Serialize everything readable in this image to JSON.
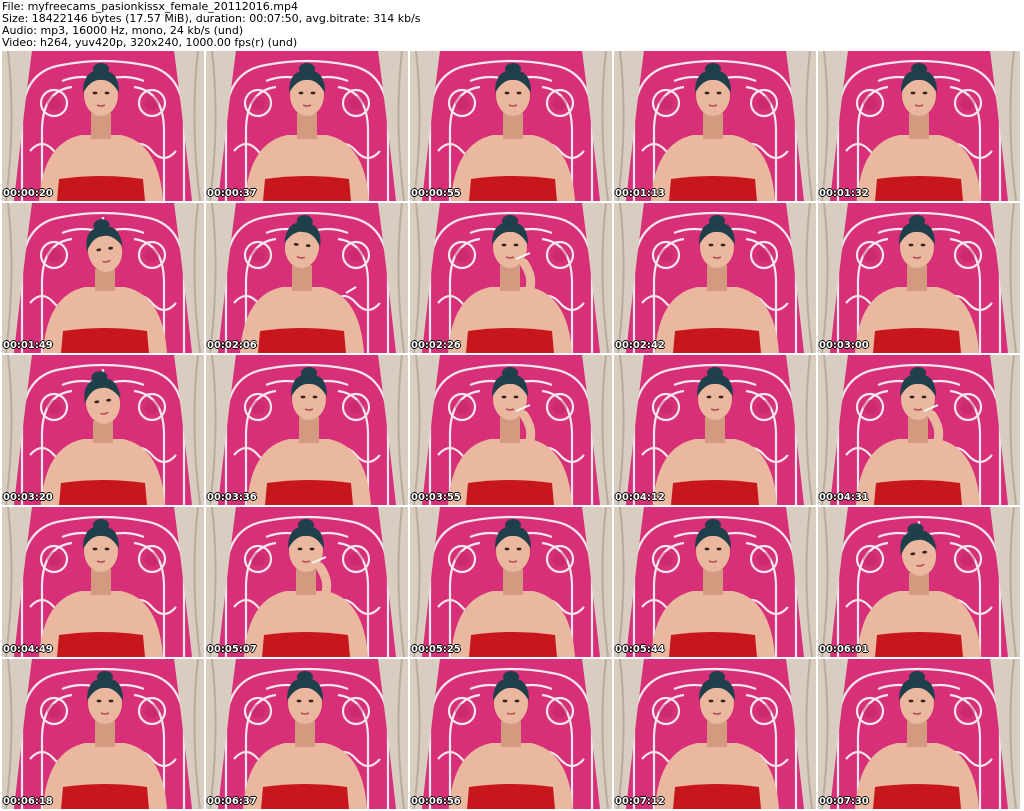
{
  "header": {
    "file": "File: myfreecams_pasionkissx_female_20112016.mp4",
    "size": "Size: 18422146 bytes (17.57 MiB), duration: 00:07:50, avg.bitrate: 314 kb/s",
    "audio": "Audio: mp3, 16000 Hz, mono, 24 kb/s (und)",
    "video": "Video: h264, yuv420p, 320x240, 1000.00 fps(r) (und)"
  },
  "thumbnails": [
    {
      "timestamp": "00:00:20",
      "pose": "neutral"
    },
    {
      "timestamp": "00:00:37",
      "pose": "neutral"
    },
    {
      "timestamp": "00:00:55",
      "pose": "neutral"
    },
    {
      "timestamp": "00:01:13",
      "pose": "neutral"
    },
    {
      "timestamp": "00:01:32",
      "pose": "neutral"
    },
    {
      "timestamp": "00:01:49",
      "pose": "down"
    },
    {
      "timestamp": "00:02:06",
      "pose": "lean"
    },
    {
      "timestamp": "00:02:26",
      "pose": "smoke"
    },
    {
      "timestamp": "00:02:42",
      "pose": "neutral"
    },
    {
      "timestamp": "00:03:00",
      "pose": "neutral"
    },
    {
      "timestamp": "00:03:20",
      "pose": "down"
    },
    {
      "timestamp": "00:03:36",
      "pose": "neutral"
    },
    {
      "timestamp": "00:03:55",
      "pose": "smoke"
    },
    {
      "timestamp": "00:04:12",
      "pose": "neutral"
    },
    {
      "timestamp": "00:04:31",
      "pose": "smoke"
    },
    {
      "timestamp": "00:04:49",
      "pose": "neutral"
    },
    {
      "timestamp": "00:05:07",
      "pose": "smoke"
    },
    {
      "timestamp": "00:05:25",
      "pose": "neutral"
    },
    {
      "timestamp": "00:05:44",
      "pose": "neutral"
    },
    {
      "timestamp": "00:06:01",
      "pose": "down"
    },
    {
      "timestamp": "00:06:18",
      "pose": "neutral"
    },
    {
      "timestamp": "00:06:37",
      "pose": "neutral"
    },
    {
      "timestamp": "00:06:56",
      "pose": "neutral"
    },
    {
      "timestamp": "00:07:12",
      "pose": "neutral"
    },
    {
      "timestamp": "00:07:30",
      "pose": "neutral"
    }
  ],
  "colors": {
    "wall": "#d72f78",
    "wall_dark": "#b91f5f",
    "headboard": "#f3e6ec",
    "curtain": "#d8cdc0",
    "curtain_shadow": "#b9ac9d",
    "skin": "#e9b89f",
    "skin_shade": "#d49a80",
    "hair": "#1f3f4a",
    "top": "#c8161d"
  }
}
